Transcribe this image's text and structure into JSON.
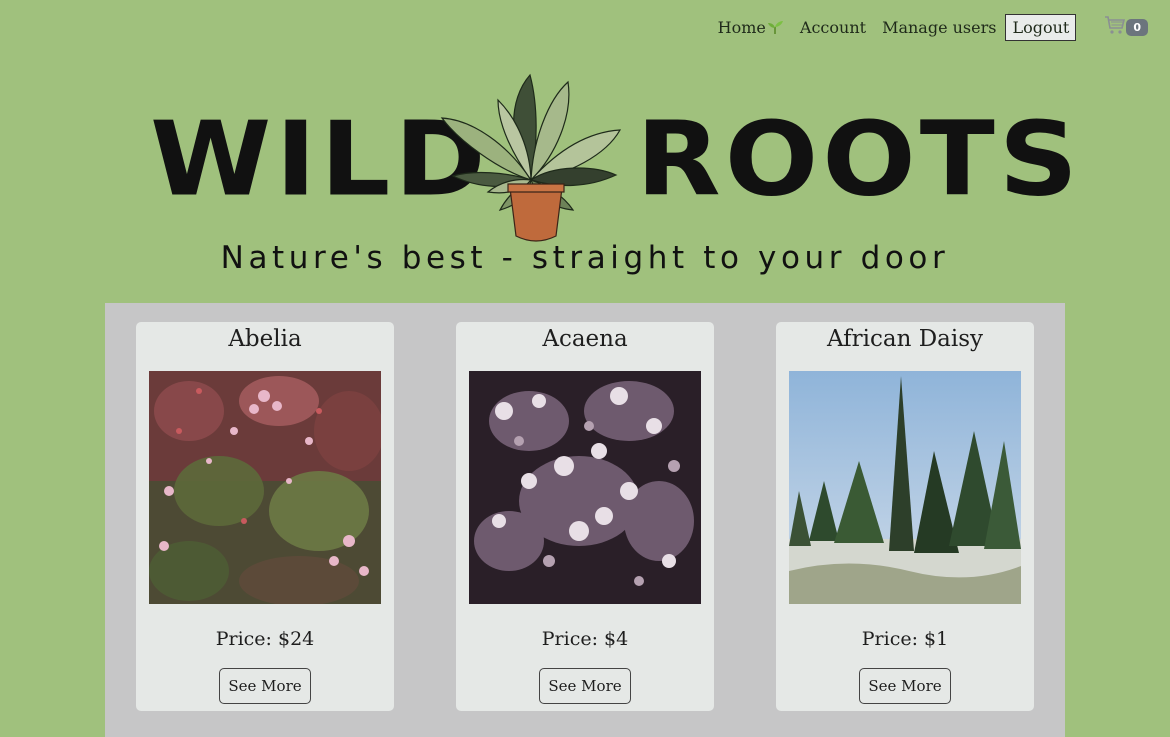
{
  "nav": {
    "home_label": "Home",
    "home_icon": "sprout-icon",
    "account_label": "Account",
    "manage_users_label": "Manage users",
    "logout_label": "Logout",
    "cart_icon": "cart-icon",
    "cart_count": "0"
  },
  "logo": {
    "word_left": "WILD",
    "word_right": "ROOTS"
  },
  "tagline": "Nature's best - straight to your door",
  "products": [
    {
      "name": "Abelia",
      "price": "Price: $24",
      "button": "See More"
    },
    {
      "name": "Acaena",
      "price": "Price: $4",
      "button": "See More"
    },
    {
      "name": "African Daisy",
      "price": "Price: $1",
      "button": "See More"
    }
  ],
  "colors": {
    "page_bg": "#a0c17d",
    "grid_bg": "#c6c6c7",
    "card_bg": "#e5e8e6",
    "badge_bg": "#6c757d"
  }
}
